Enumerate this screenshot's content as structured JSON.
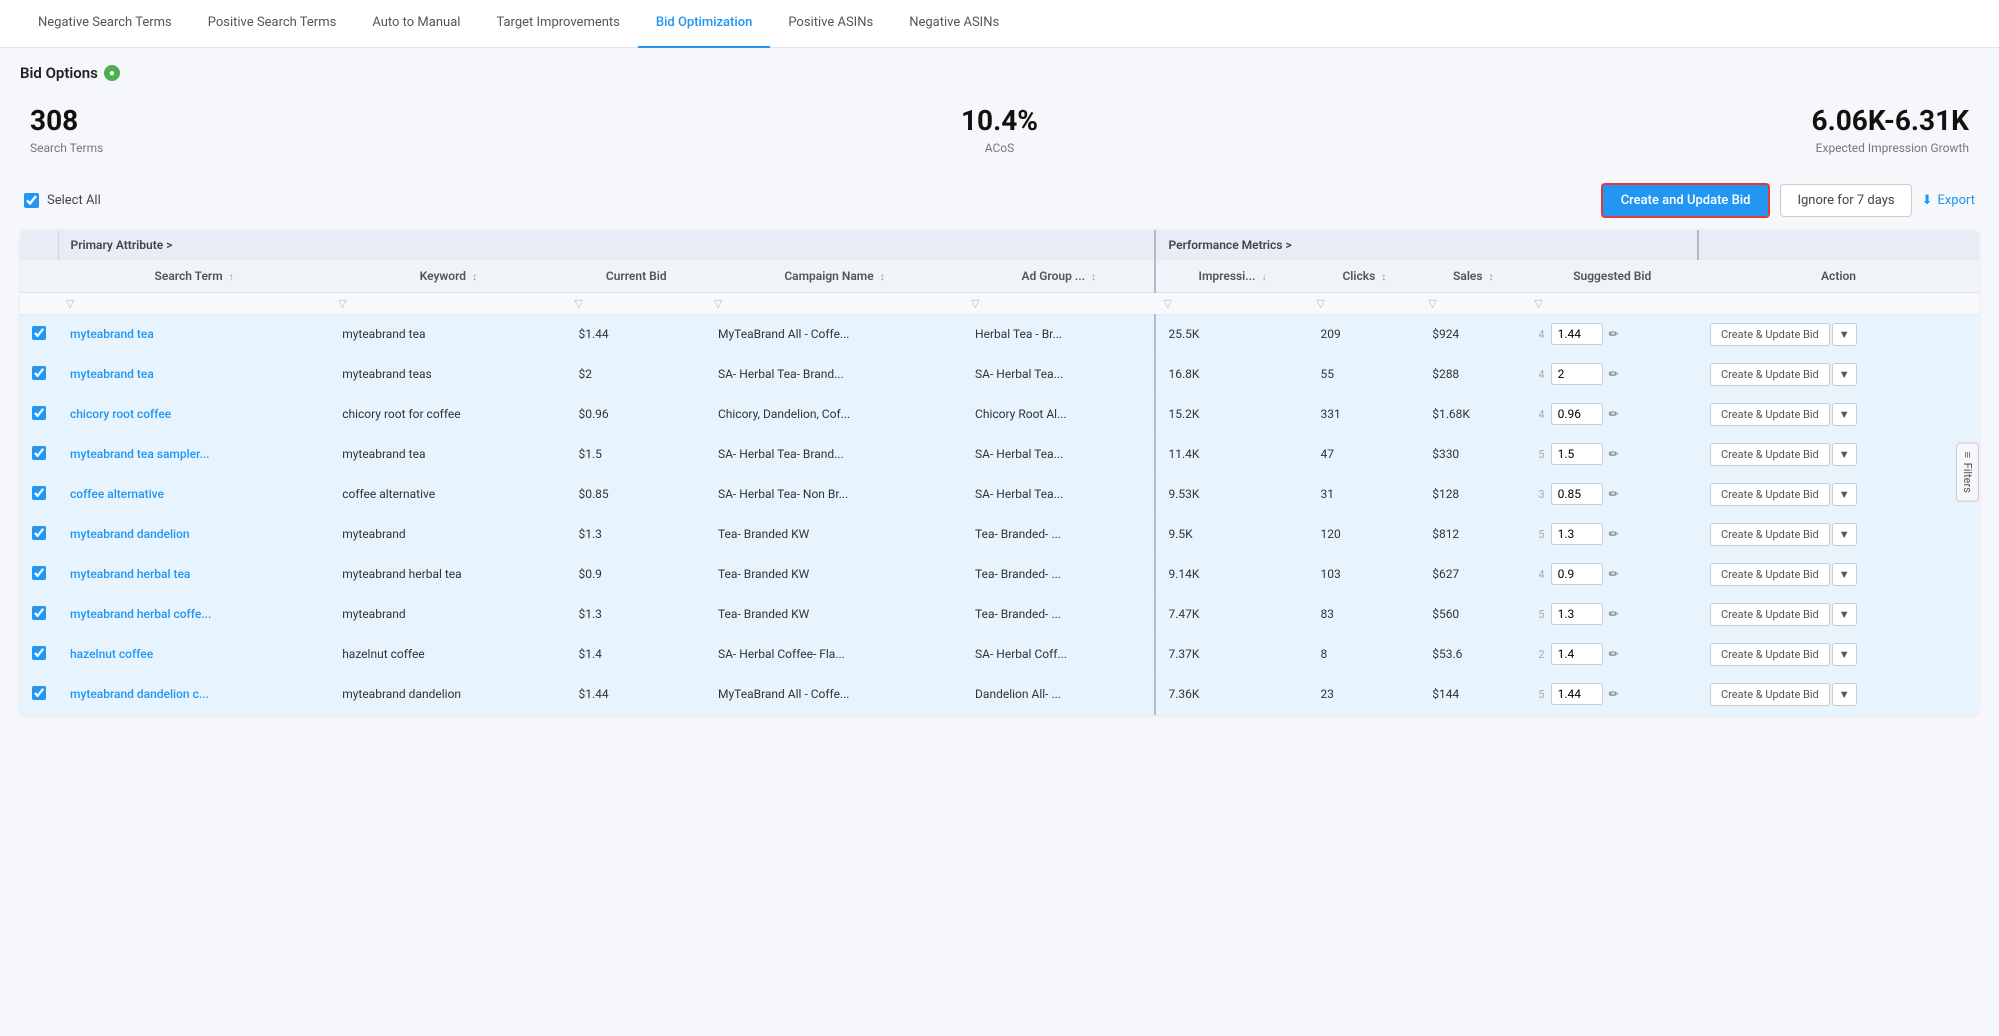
{
  "nav": {
    "items": [
      {
        "label": "Negative Search Terms",
        "active": false
      },
      {
        "label": "Positive Search Terms",
        "active": false
      },
      {
        "label": "Auto to Manual",
        "active": false
      },
      {
        "label": "Target Improvements",
        "active": false
      },
      {
        "label": "Bid Optimization",
        "active": true
      },
      {
        "label": "Positive ASINs",
        "active": false
      },
      {
        "label": "Negative ASINs",
        "active": false
      }
    ]
  },
  "bid_options": {
    "title": "Bid Options",
    "info_symbol": "●"
  },
  "stats": {
    "left": {
      "value": "308",
      "label": "Search Terms"
    },
    "center": {
      "value": "10.4%",
      "label": "ACoS"
    },
    "right": {
      "value": "6.06K-6.31K",
      "label": "Expected Impression Growth"
    }
  },
  "toolbar": {
    "select_all": "Select All",
    "create_update_btn": "Create and Update Bid",
    "ignore_btn": "Ignore for 7 days",
    "export_btn": "Export",
    "download_icon": "⬇"
  },
  "table": {
    "group_headers": [
      {
        "label": "",
        "colspan": 1
      },
      {
        "label": "Primary Attribute >",
        "colspan": 5
      },
      {
        "label": "Performance Metrics >",
        "colspan": 4
      },
      {
        "label": "",
        "colspan": 2
      }
    ],
    "columns": [
      {
        "label": "Search Term",
        "sortable": true,
        "sort_dir": "asc"
      },
      {
        "label": "Keyword",
        "sortable": true
      },
      {
        "label": "Current Bid",
        "sortable": false
      },
      {
        "label": "Campaign Name",
        "sortable": true
      },
      {
        "label": "Ad Group ...",
        "sortable": true
      },
      {
        "label": "Impressi...",
        "sortable": true,
        "sort_dir": "desc"
      },
      {
        "label": "Clicks",
        "sortable": true
      },
      {
        "label": "Sales",
        "sortable": true
      },
      {
        "label": "Suggested Bid",
        "sortable": false
      },
      {
        "label": "Action",
        "sortable": false
      }
    ],
    "rows": [
      {
        "checked": true,
        "search_term": "myteabrand tea",
        "keyword": "myteabrand tea",
        "current_bid": "$1.44",
        "campaign_name": "MyTeaBrand All - Coffe...",
        "ad_group": "Herbal Tea - Br...",
        "impressions": "25.5K",
        "clicks": "209",
        "sales": "$924",
        "suggested_col": "4",
        "suggested_bid": "1.44"
      },
      {
        "checked": true,
        "search_term": "myteabrand tea",
        "keyword": "myteabrand teas",
        "current_bid": "$2",
        "campaign_name": "SA- Herbal Tea- Brand...",
        "ad_group": "SA- Herbal Tea...",
        "impressions": "16.8K",
        "clicks": "55",
        "sales": "$288",
        "suggested_col": "4",
        "suggested_bid": "2"
      },
      {
        "checked": true,
        "search_term": "chicory root coffee",
        "keyword": "chicory root for coffee",
        "current_bid": "$0.96",
        "campaign_name": "Chicory, Dandelion, Cof...",
        "ad_group": "Chicory Root Al...",
        "impressions": "15.2K",
        "clicks": "331",
        "sales": "$1.68K",
        "suggested_col": "4",
        "suggested_bid": "0.96"
      },
      {
        "checked": true,
        "search_term": "myteabrand tea sampler...",
        "keyword": "myteabrand tea",
        "current_bid": "$1.5",
        "campaign_name": "SA- Herbal Tea- Brand...",
        "ad_group": "SA- Herbal Tea...",
        "impressions": "11.4K",
        "clicks": "47",
        "sales": "$330",
        "suggested_col": "5",
        "suggested_bid": "1.5"
      },
      {
        "checked": true,
        "search_term": "coffee alternative",
        "keyword": "coffee alternative",
        "current_bid": "$0.85",
        "campaign_name": "SA- Herbal Tea- Non Br...",
        "ad_group": "SA- Herbal Tea...",
        "impressions": "9.53K",
        "clicks": "31",
        "sales": "$128",
        "suggested_col": "3",
        "suggested_bid": "0.85"
      },
      {
        "checked": true,
        "search_term": "myteabrand dandelion",
        "keyword": "myteabrand",
        "current_bid": "$1.3",
        "campaign_name": "Tea- Branded KW",
        "ad_group": "Tea- Branded- ...",
        "impressions": "9.5K",
        "clicks": "120",
        "sales": "$812",
        "suggested_col": "5",
        "suggested_bid": "1.3"
      },
      {
        "checked": true,
        "search_term": "myteabrand herbal tea",
        "keyword": "myteabrand herbal tea",
        "current_bid": "$0.9",
        "campaign_name": "Tea- Branded KW",
        "ad_group": "Tea- Branded- ...",
        "impressions": "9.14K",
        "clicks": "103",
        "sales": "$627",
        "suggested_col": "4",
        "suggested_bid": "0.9"
      },
      {
        "checked": true,
        "search_term": "myteabrand herbal coffe...",
        "keyword": "myteabrand",
        "current_bid": "$1.3",
        "campaign_name": "Tea- Branded KW",
        "ad_group": "Tea- Branded- ...",
        "impressions": "7.47K",
        "clicks": "83",
        "sales": "$560",
        "suggested_col": "5",
        "suggested_bid": "1.3"
      },
      {
        "checked": true,
        "search_term": "hazelnut coffee",
        "keyword": "hazelnut coffee",
        "current_bid": "$1.4",
        "campaign_name": "SA- Herbal Coffee- Fla...",
        "ad_group": "SA- Herbal Coff...",
        "impressions": "7.37K",
        "clicks": "8",
        "sales": "$53.6",
        "suggested_col": "2",
        "suggested_bid": "1.4"
      },
      {
        "checked": true,
        "search_term": "myteabrand dandelion c...",
        "keyword": "myteabrand dandelion",
        "current_bid": "$1.44",
        "campaign_name": "MyTeaBrand All - Coffe...",
        "ad_group": "Dandelion All- ...",
        "impressions": "7.36K",
        "clicks": "23",
        "sales": "$144",
        "suggested_col": "5",
        "suggested_bid": "1.44"
      }
    ],
    "action_btn_label": "Create & Update Bid",
    "filters_label": "Filters"
  }
}
